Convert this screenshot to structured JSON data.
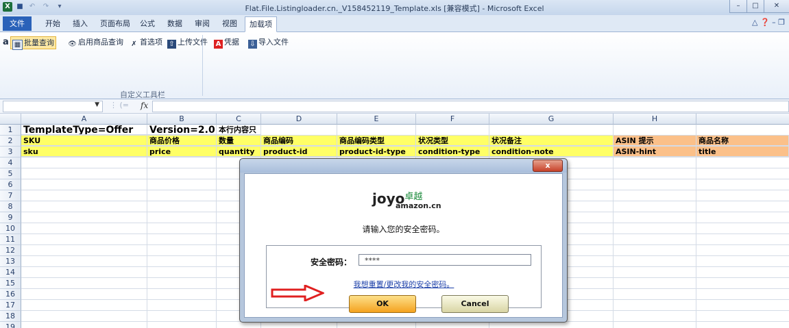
{
  "window": {
    "title": "Flat.File.Listingloader.cn._V158452119_Template.xls  [兼容模式] - Microsoft Excel",
    "app_icon": "X",
    "controls": [
      "–",
      "□",
      "✕"
    ]
  },
  "ribbon": {
    "tabs": [
      "文件",
      "开始",
      "插入",
      "页面布局",
      "公式",
      "数据",
      "审阅",
      "视图",
      "加载项"
    ],
    "active_tab": "加载项",
    "amazon_glyph": "a",
    "buttons": [
      {
        "label": "批量查询",
        "icon": "grid-icon"
      },
      {
        "label": "启用商品查询",
        "icon": "eye-icon"
      },
      {
        "label": "首选项",
        "icon": "tools-icon"
      },
      {
        "label": "上传文件",
        "icon": "upload-icon"
      },
      {
        "label": "凭据",
        "icon": "credential-icon"
      },
      {
        "label": "导入文件",
        "icon": "import-icon"
      }
    ],
    "group_label": "自定义工具栏"
  },
  "formula_bar": {
    "fx": "fx",
    "value": ""
  },
  "sheet": {
    "columns": [
      "A",
      "B",
      "C",
      "D",
      "E",
      "F",
      "G",
      "H",
      ""
    ],
    "rows": [
      "1",
      "2",
      "3",
      "4",
      "5",
      "6",
      "7",
      "8",
      "9",
      "10",
      "11",
      "12",
      "13",
      "14",
      "15",
      "16",
      "17",
      "18",
      "19"
    ],
    "row1": [
      "TemplateType=Offer",
      "Version=2.0",
      "本行内容只"
    ],
    "row2": [
      "SKU",
      "商品价格",
      "数量",
      "商品编码",
      "商品编码类型",
      "状况类型",
      "状况备注",
      "ASIN 提示",
      "商品名称"
    ],
    "row3": [
      "sku",
      "price",
      "quantity",
      "product-id",
      "product-id-type",
      "condition-type",
      "condition-note",
      "ASIN-hint",
      "title"
    ]
  },
  "dialog": {
    "close_label": "x",
    "logo_text": "joyo",
    "logo_cn": "卓越",
    "logo_sub": "amazon.cn",
    "prompt": "请输入您的安全密码。",
    "password_label": "安全密码：",
    "password_value": "****",
    "reset_link": "我想重置/更改我的安全密码。",
    "ok_label": "OK",
    "cancel_label": "Cancel"
  },
  "colors": {
    "header_yellow": "#ffff66",
    "header_orange": "#fbc089",
    "arrow_red": "#e02020"
  }
}
